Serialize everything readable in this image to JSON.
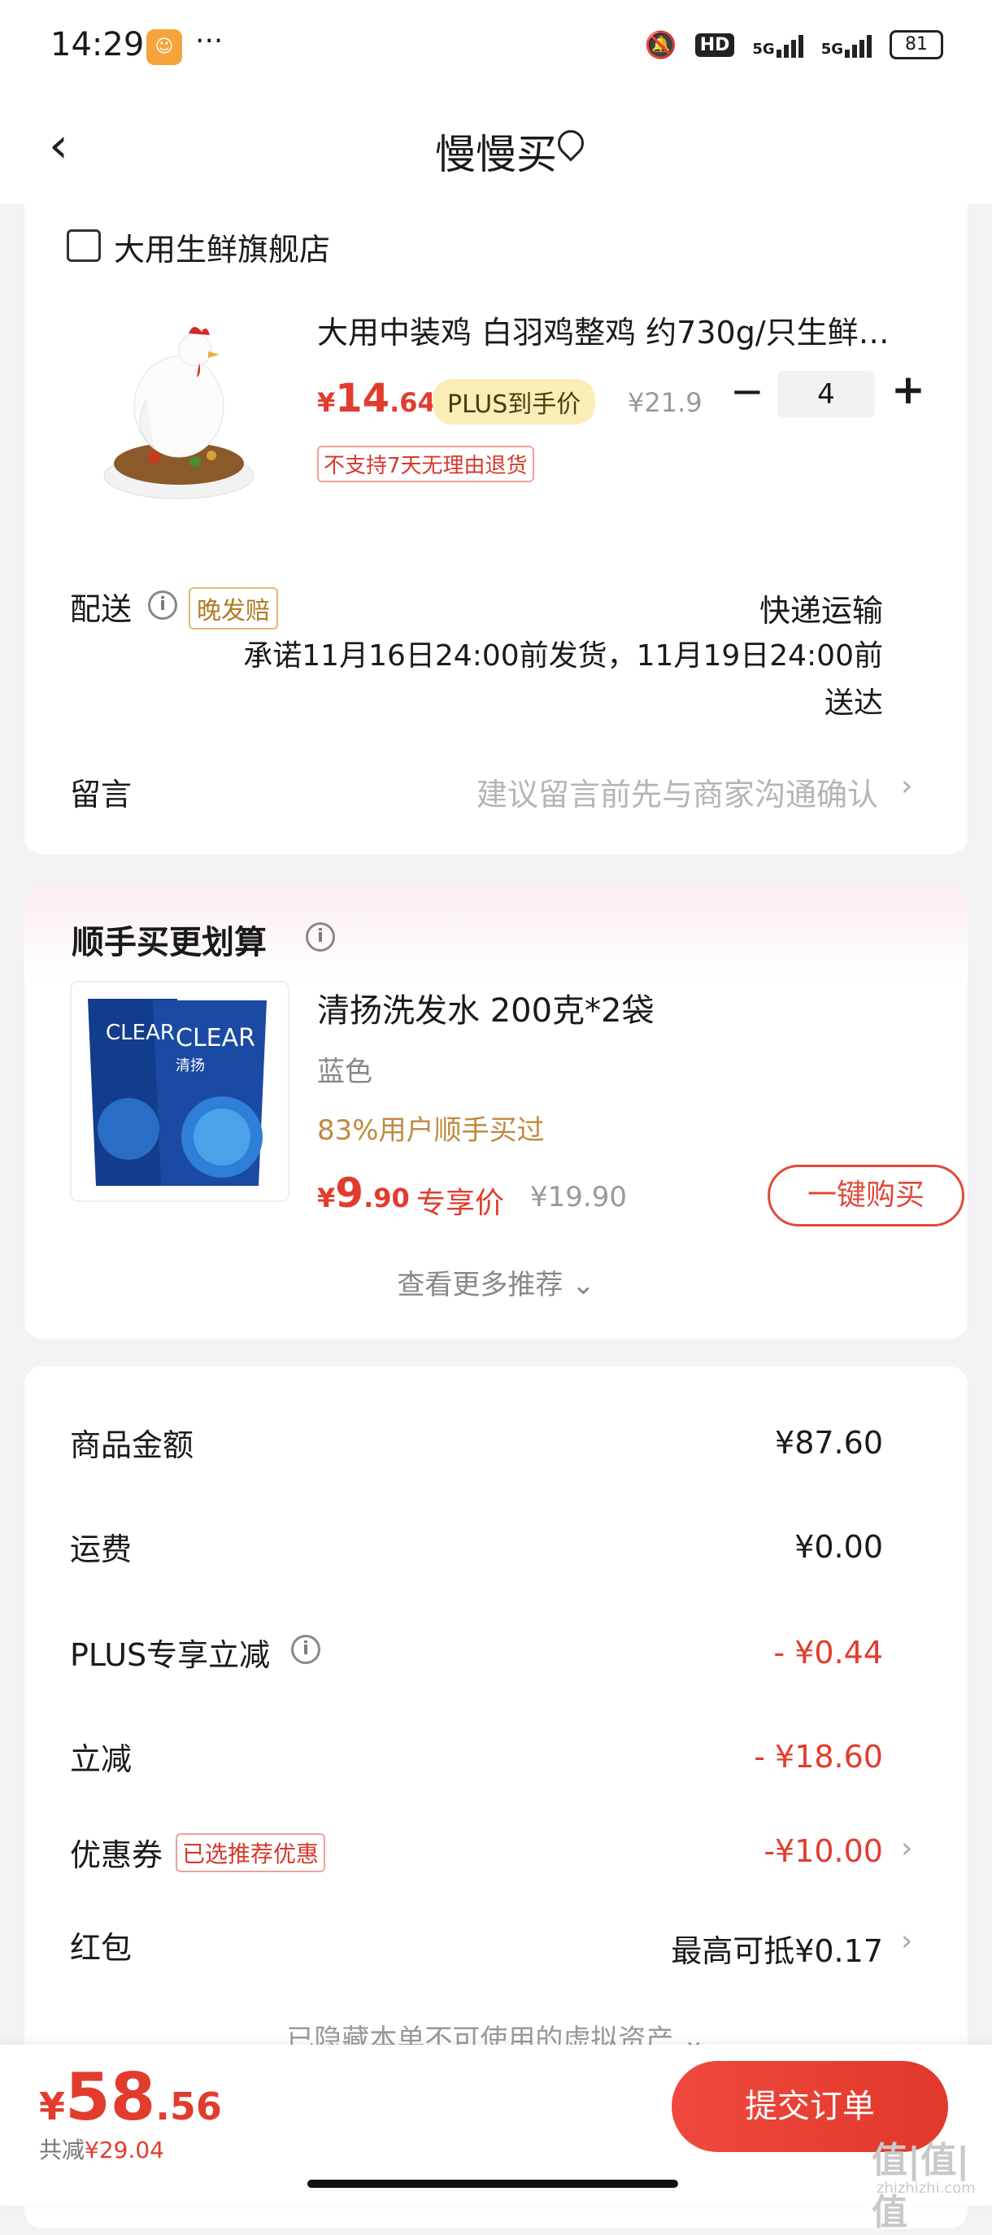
{
  "status_bar": {
    "time": "14:29",
    "dots": "···",
    "hd": "HD",
    "net1": "5G",
    "net2": "5G",
    "battery": "81"
  },
  "nav": {
    "title": "慢慢买"
  },
  "shop": {
    "store_name": "大用生鲜旗舰店",
    "product_title": "大用中装鸡 白羽鸡整鸡 约730g/只生鲜…",
    "price_symbol": "¥",
    "price_int": "14",
    "price_dec": ".64",
    "plus_tag": "PLUS到手价",
    "orig_price": "¥21.9",
    "qty": "4",
    "no_return": "不支持7天无理由退货",
    "delivery_label": "配送",
    "late_tag": "晚发赔",
    "ship_method": "快递运输",
    "ship_promise": "承诺11月16日24:00前发货，11月19日24:00前送达",
    "message_label": "留言",
    "message_hint": "建议留言前先与商家沟通确认"
  },
  "recommend": {
    "title": "顺手买更划算",
    "name": "清扬洗发水 200克*2袋",
    "color": "蓝色",
    "rate": "83%用户顺手买过",
    "price_symbol": "¥",
    "price_int": "9",
    "price_dec": ".90",
    "exclusive": "专享价",
    "orig_price": "¥19.90",
    "buy_button": "一键购买",
    "more": "查看更多推荐"
  },
  "summary": {
    "goods_label": "商品金额",
    "goods_value": "¥87.60",
    "freight_label": "运费",
    "freight_value": "¥0.00",
    "plus_label": "PLUS专享立减",
    "plus_value": "- ¥0.44",
    "instant_label": "立减",
    "instant_value": "- ¥18.60",
    "coupon_label": "优惠券",
    "coupon_tag": "已选推荐优惠",
    "coupon_value": "-¥10.00",
    "redpacket_label": "红包",
    "redpacket_value": "最高可抵¥0.17",
    "hidden_note": "已隐藏本单不可使用的虚拟资产"
  },
  "bottom": {
    "price_symbol": "¥",
    "total_int": "58",
    "total_dec": ".56",
    "saved_prefix": "共减",
    "saved_value": "¥29.04",
    "submit": "提交订单"
  },
  "watermark": {
    "logo": "值|值|值",
    "url": "zhizhizhi.com"
  },
  "colors": {
    "accent": "#e23c2e",
    "plus_tag_bg": "#fbedb6",
    "background": "#f3f3f5"
  }
}
